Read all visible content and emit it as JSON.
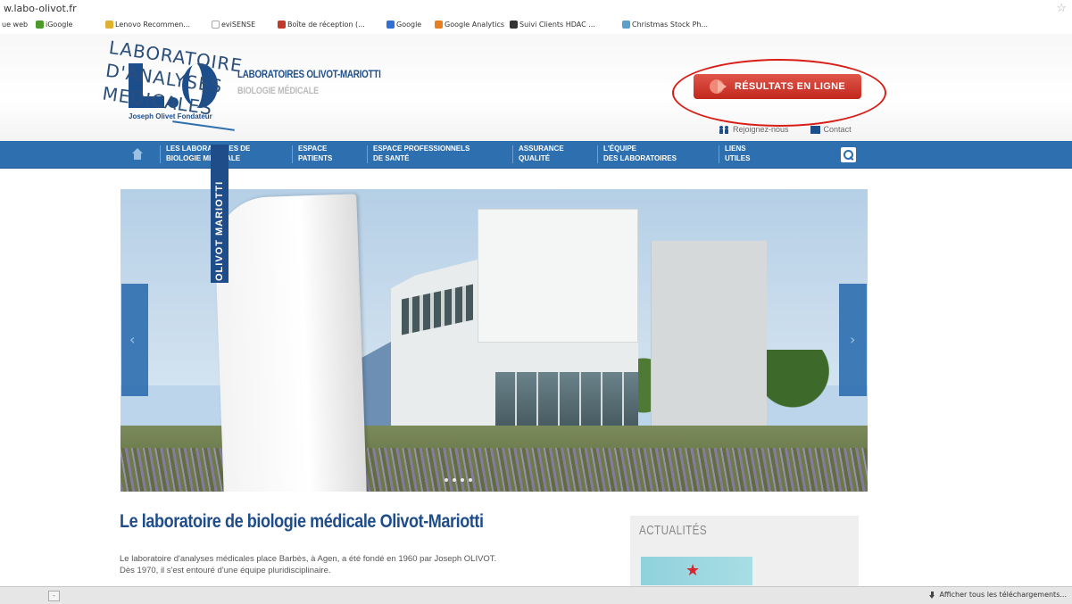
{
  "browser": {
    "url": "w.labo-olivot.fr",
    "bookmarks": [
      {
        "label": "ue web",
        "color": "#ffffff"
      },
      {
        "label": "iGoogle",
        "color": "#4c9a2a"
      },
      {
        "label": "Lenovo Recommen...",
        "color": "#e0b030"
      },
      {
        "label": "eviSENSE",
        "color": "#dddddd"
      },
      {
        "label": "Boîte de réception (...",
        "color": "#c0392b"
      },
      {
        "label": "Google",
        "color": "#2f6fd6"
      },
      {
        "label": "Google Analytics",
        "color": "#e67e22"
      },
      {
        "label": "Suivi Clients HDAC ...",
        "color": "#333333"
      },
      {
        "label": "Christmas Stock Ph...",
        "color": "#5aa0c8"
      }
    ]
  },
  "header": {
    "logo_founder": "Joseph Olivet Fondateur",
    "lab_name": "LABORATOIRES OLIVOT-MARIOTTI",
    "lab_sub": "BIOLOGIE MÉDICALE",
    "results_button": "RÉSULTATS EN LIGNE",
    "contact_people": "Rejoignez-nous",
    "contact": "Contact"
  },
  "nav": {
    "items": [
      {
        "line1": "LES LABORATOIRES DE",
        "line2": "BIOLOGIE MÉDICALE"
      },
      {
        "line1": "ESPACE",
        "line2": "PATIENTS"
      },
      {
        "line1": "ESPACE PROFESSIONNELS",
        "line2": "DE SANTÉ"
      },
      {
        "line1": "ASSURANCE",
        "line2": "QUALITÉ"
      },
      {
        "line1": "L'ÉQUIPE",
        "line2": "DES LABORATOIRES"
      },
      {
        "line1": "LIENS",
        "line2": "UTILES"
      }
    ]
  },
  "hero": {
    "sign_line1": "LABORATOIRE",
    "sign_line2": "D'ANALYSES",
    "sign_line3": "MEDICALES",
    "sign_band": "OLIVOT MARIOTTI",
    "prev_arrow": "‹",
    "next_arrow": "›"
  },
  "content": {
    "title": "Le laboratoire de biologie médicale Olivot-Mariotti",
    "p1": "Le laboratoire d'analyses médicales place Barbès, à Agen, a été fondé en 1960 par Joseph OLIVOT.",
    "p2": "Dès 1970, il s'est entouré d'une équipe pluridisciplinaire.",
    "news_title": "ACTUALITÉS"
  },
  "download_bar": {
    "button": "-",
    "show_all": "Afficher tous les téléchargements..."
  }
}
